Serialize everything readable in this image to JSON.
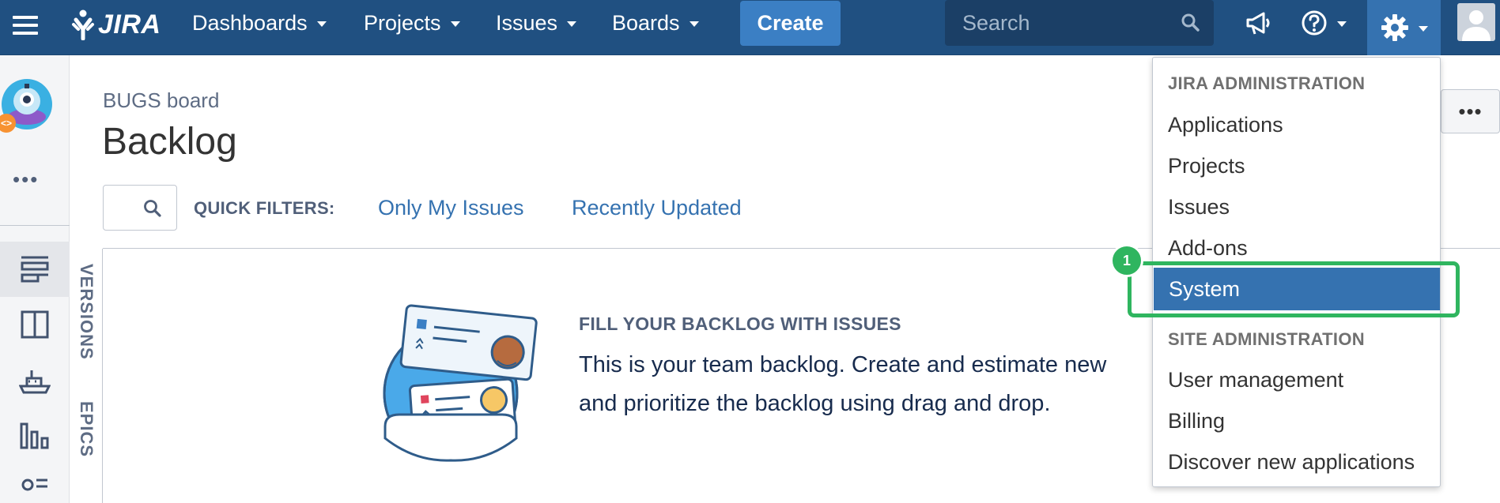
{
  "topnav": {
    "logo_text": "JIRA",
    "menus": [
      {
        "label": "Dashboards"
      },
      {
        "label": "Projects"
      },
      {
        "label": "Issues"
      },
      {
        "label": "Boards"
      }
    ],
    "create_label": "Create",
    "search_placeholder": "Search",
    "icons": [
      "menu-icon",
      "jira-logo-icon",
      "search-icon",
      "megaphone-icon",
      "help-icon",
      "gear-icon",
      "user-avatar"
    ]
  },
  "sidebar": {
    "project_badge": "<>",
    "more_label": "•••",
    "items": [
      "backlog-icon",
      "active-sprints-icon",
      "releases-icon",
      "reports-icon",
      "components-icon"
    ]
  },
  "main": {
    "board_name": "BUGS board",
    "title": "Backlog",
    "quick_filters_label": "QUICK FILTERS:",
    "quick_filters": [
      "Only My Issues",
      "Recently Updated"
    ],
    "more_actions": "•••",
    "side_tabs": [
      "VERSIONS",
      "EPICS"
    ],
    "empty_state": {
      "heading": "FILL YOUR BACKLOG WITH ISSUES",
      "line1": "This is your team backlog. Create and estimate new",
      "line2": "and prioritize the backlog using drag and drop."
    }
  },
  "admin_menu": {
    "jira_heading": "JIRA ADMINISTRATION",
    "jira_items": [
      "Applications",
      "Projects",
      "Issues",
      "Add-ons",
      "System"
    ],
    "selected": "System",
    "site_heading": "SITE ADMINISTRATION",
    "site_items": [
      "User management",
      "Billing",
      "Discover new applications"
    ]
  },
  "annotation": {
    "number": "1"
  },
  "colors": {
    "nav_bg": "#205081",
    "create_button": "#3b7fc4",
    "selected_item": "#3572b0",
    "link": "#3572b0",
    "callout": "#2fb55f"
  }
}
